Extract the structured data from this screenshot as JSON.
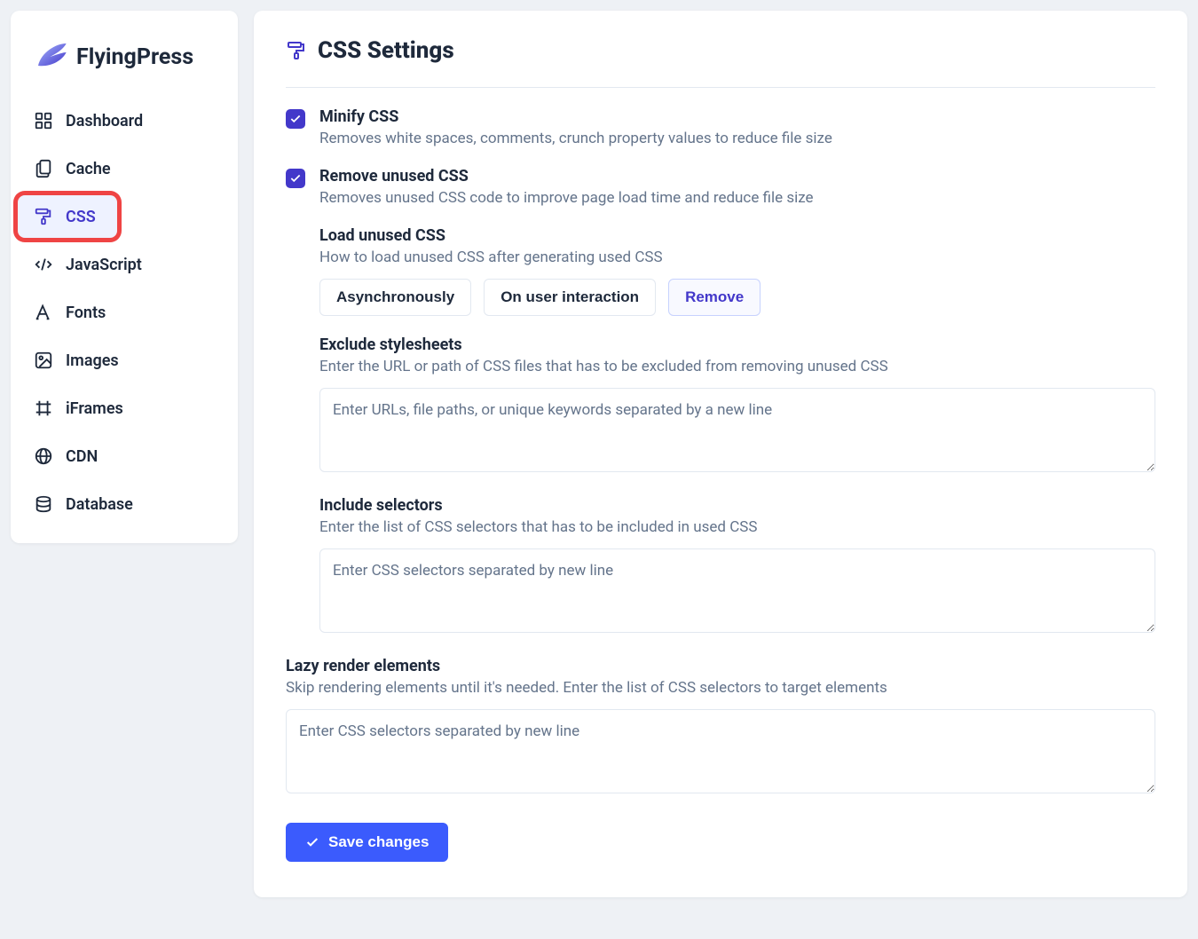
{
  "brand": "FlyingPress",
  "sidebar": {
    "items": [
      {
        "label": "Dashboard"
      },
      {
        "label": "Cache"
      },
      {
        "label": "CSS"
      },
      {
        "label": "JavaScript"
      },
      {
        "label": "Fonts"
      },
      {
        "label": "Images"
      },
      {
        "label": "iFrames"
      },
      {
        "label": "CDN"
      },
      {
        "label": "Database"
      }
    ]
  },
  "page_title": "CSS Settings",
  "minify": {
    "label": "Minify CSS",
    "desc": "Removes white spaces, comments, crunch property values to reduce file size"
  },
  "remove_unused": {
    "label": "Remove unused CSS",
    "desc": "Removes unused CSS code to improve page load time and reduce file size"
  },
  "load_unused": {
    "label": "Load unused CSS",
    "desc": "How to load unused CSS after generating used CSS",
    "options": [
      "Asynchronously",
      "On user interaction",
      "Remove"
    ]
  },
  "exclude": {
    "label": "Exclude stylesheets",
    "desc": "Enter the URL or path of CSS files that has to be excluded from removing unused CSS",
    "placeholder": "Enter URLs, file paths, or unique keywords separated by a new line"
  },
  "include": {
    "label": "Include selectors",
    "desc": "Enter the list of CSS selectors that has to be included in used CSS",
    "placeholder": "Enter CSS selectors separated by new line"
  },
  "lazy": {
    "label": "Lazy render elements",
    "desc": "Skip rendering elements until it's needed. Enter the list of CSS selectors to target elements",
    "placeholder": "Enter CSS selectors separated by new line"
  },
  "save_label": "Save changes"
}
